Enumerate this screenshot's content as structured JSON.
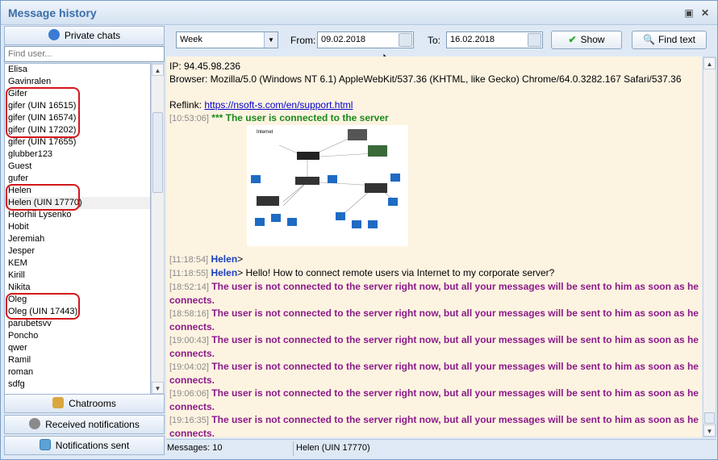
{
  "window": {
    "title": "Message history"
  },
  "left": {
    "private_chats": "Private chats",
    "find_placeholder": "Find user...",
    "users": [
      "Elisa",
      "Gavinralen",
      "Gifer",
      "gifer (UIN 16515)",
      "gifer (UIN 16574)",
      "gifer (UIN 17202)",
      "gifer (UIN 17655)",
      "glubber123",
      "Guest",
      "gufer",
      "Helen",
      "Helen (UIN 17770)",
      "Heorhii Lysenko",
      "Hobit",
      "Jeremiah",
      "Jesper",
      "KEM",
      "Kirill",
      "Nikita",
      "Oleg",
      "Oleg (UIN 17443)",
      "parubetsvv",
      "Poncho",
      "qwer",
      "Ramil",
      "roman",
      "sdfg"
    ],
    "chatrooms": "Chatrooms",
    "received_notifications": "Received notifications",
    "notifications_sent": "Notifications sent"
  },
  "toolbar": {
    "period": "Week",
    "from_label": "From:",
    "from_value": "09.02.2018",
    "to_label": "To:",
    "to_value": "16.02.2018",
    "show_label": "Show",
    "find_label": "Find text"
  },
  "messages": {
    "ip": "IP: 94.45.98.236",
    "browser": "Browser: Mozilla/5.0 (Windows NT 6.1) AppleWebKit/537.36 (KHTML, like Gecko) Chrome/64.0.3282.167 Safari/537.36",
    "reflink_label": "Reflink:",
    "reflink_url": "https://nsoft-s.com/en/support.html",
    "connected_ts": "[10:53:06]",
    "connected_text": "*** The user is connected to the server",
    "m1_ts": "[11:18:54]",
    "m1_nick": "Helen",
    "m1_text": ">",
    "m2_ts": "[11:18:55]",
    "m2_nick": "Helen",
    "m2_text": "> Hello! How to connect remote users via Internet to my corporate server?",
    "offline_text": "The user is not connected to the server right now, but all your messages will be sent to him as soon as he connects.",
    "offline_ts": [
      "[18:52:14]",
      "[18:58:16]",
      "[19:00:43]",
      "[19:04:02]",
      "[19:06:06]",
      "[19:16:35]"
    ],
    "image_caption": "Internet"
  },
  "status": {
    "messages": "Messages: 10",
    "user": "Helen (UIN 17770)"
  }
}
